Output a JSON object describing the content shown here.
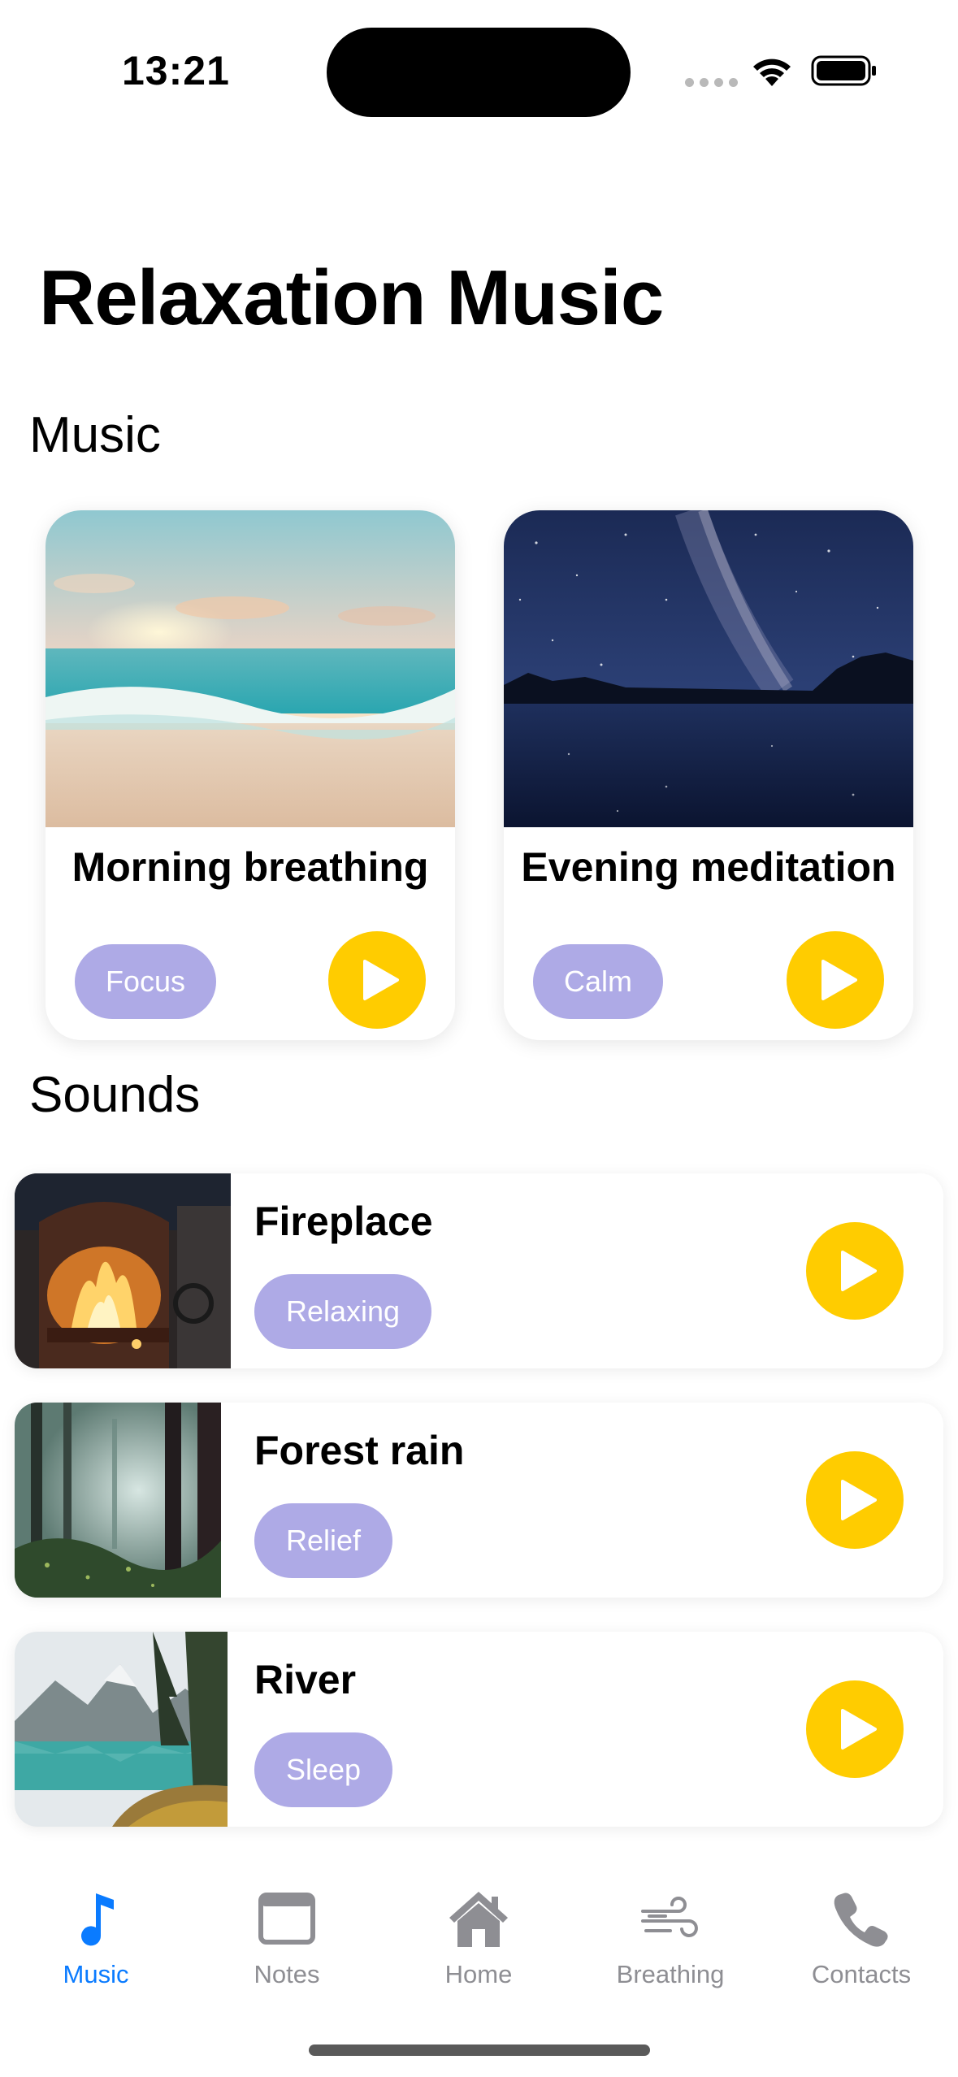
{
  "status_bar": {
    "time": "13:21"
  },
  "page": {
    "title": "Relaxation Music"
  },
  "sections": {
    "music": "Music",
    "sounds": "Sounds"
  },
  "music_cards": [
    {
      "title": "Morning breathing",
      "tag": "Focus",
      "image": "beach-sunset"
    },
    {
      "title": "Evening meditation",
      "tag": "Calm",
      "image": "night-sky-lake"
    }
  ],
  "sounds": [
    {
      "title": "Fireplace",
      "tag": "Relaxing",
      "image": "fireplace"
    },
    {
      "title": "Forest rain",
      "tag": "Relief",
      "image": "misty-forest"
    },
    {
      "title": "River",
      "tag": "Sleep",
      "image": "mountain-lake"
    }
  ],
  "tab_bar": {
    "items": [
      {
        "label": "Music",
        "icon": "music-note-icon",
        "active": true
      },
      {
        "label": "Notes",
        "icon": "notes-window-icon",
        "active": false
      },
      {
        "label": "Home",
        "icon": "house-icon",
        "active": false
      },
      {
        "label": "Breathing",
        "icon": "wind-icon",
        "active": false
      },
      {
        "label": "Contacts",
        "icon": "phone-icon",
        "active": false
      }
    ]
  },
  "colors": {
    "accent_yellow": "#ffcc00",
    "tag_purple": "#aeaae6",
    "active_blue": "#0a7bff",
    "inactive_gray": "#8e8e93"
  }
}
